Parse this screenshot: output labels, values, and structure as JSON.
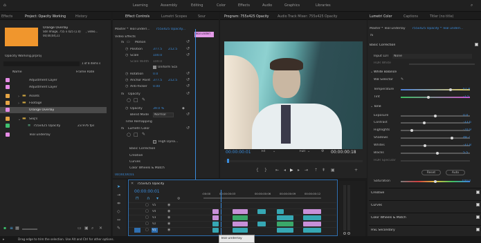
{
  "workspaces": [
    "Learning",
    "Assembly",
    "Editing",
    "Color",
    "Effects",
    "Audio",
    "Graphics",
    "Libraries"
  ],
  "project_panel": {
    "tabs": [
      "Effects",
      "Project: Opacity Working",
      "History"
    ],
    "clip_name": "Orange Overlay",
    "clip_info": "Still Image, 755 x 425 (1.0)",
    "clip_info2": ", video...",
    "clip_duration": "00;00;04;21",
    "project_file": "Opacity Working.prproj",
    "item_count": "1 of 8 items s",
    "col_name": "Name",
    "col_rate": "Frame Rate",
    "items": [
      {
        "name": "Adjustment Layer",
        "color": "#e58be6",
        "rate": ""
      },
      {
        "name": "Adjustment Layer",
        "color": "#e58be6",
        "rate": ""
      },
      {
        "name": "Assets",
        "color": "#e5a545",
        "rate": ""
      },
      {
        "name": "Footage",
        "color": "#e5a545",
        "rate": ""
      },
      {
        "name": "Orange Overlay",
        "color": "#e58be6",
        "rate": ""
      },
      {
        "name": "Seq's",
        "color": "#e5a545",
        "rate": ""
      },
      {
        "name": "755x425 Opacity",
        "color": "#3fbf6f",
        "rate": "23.976 fps"
      },
      {
        "name": "Teal underlay",
        "color": "#e58be6",
        "rate": ""
      }
    ]
  },
  "effect_controls": {
    "tabs": [
      "Effect Controls",
      "Lumetri Scopes",
      "Sour"
    ],
    "master": "Master * Teal underl...",
    "clip_link": "755x425 Opacity...",
    "clip_label": "Teal underl",
    "video_effects": "Video Effects",
    "motion": "Motion",
    "position_label": "Position",
    "position_x": "377.5",
    "position_y": "212.5",
    "scale_label": "Scale",
    "scale_val": "100.0",
    "scale_width_label": "Scale Width",
    "scale_width_val": "100.0",
    "uniform": "Uniform Sca",
    "rotation_label": "Rotation",
    "rotation_val": "0.0",
    "anchor_label": "Anchor Point",
    "anchor_x": "377.5",
    "anchor_y": "212.5",
    "antiflicker_label": "Anti-flicker",
    "antiflicker_val": "0.00",
    "opacity": "Opacity",
    "opacity_label": "Opacity",
    "opacity_val": "39.0 %",
    "blend_label": "Blend Mode",
    "blend_val": "Normal",
    "time_remap": "Time Remapping",
    "lumetri": "Lumetri Color",
    "high_dyn": "High Dyna...",
    "sub_items": [
      "Basic Correction",
      "Creative",
      "Curves",
      "Color Wheels & Match"
    ],
    "timecode": "00;00;00;01"
  },
  "program_monitor": {
    "tabs": [
      "Program: 755x425 Opacity",
      "Audio Track Mixer: 755x425 Opacity"
    ],
    "timecode": "00:00:00:01",
    "fit": "Fit",
    "quality": "Full",
    "duration": "00:00:00:18"
  },
  "timeline": {
    "title": "755x425 Opacity",
    "timecode": "00:00:00:01",
    "ruler": [
      ":00:00",
      "00:00:00:03",
      "00:00:00:06",
      "00:00:00:09",
      "00:00:00:12"
    ],
    "tracks": [
      "V5",
      "V4",
      "V3",
      "V2",
      "V1"
    ]
  },
  "lumetri": {
    "tabs": [
      "Lumetri Color",
      "Captions",
      "Titler (no title)"
    ],
    "master": "Master * Teal underlay",
    "clip_link": "755x425 Opacity * Teal underl...",
    "basic": "Basic Correction",
    "input_lut_label": "Input LUT",
    "input_lut_val": "None",
    "hdr_label": "HDR White",
    "white_balance": "White Balance",
    "wb_selector": "WB Selector",
    "temperature_label": "Temperature",
    "temperature_val": "61.8",
    "tint_label": "Tint",
    "tint_val": "-2.5",
    "tone": "Tone",
    "exposure_label": "Exposure",
    "exposure_val": "0.0",
    "contrast_label": "Contrast",
    "contrast_val": "-33.6",
    "highlights_label": "Highlights",
    "highlights_val": "-70.9",
    "shadows_label": "Shadows",
    "shadows_val": "48.7",
    "whites_label": "Whites",
    "whites_val": "-31.8",
    "blacks_label": "Blacks",
    "blacks_val": "5.5",
    "hdr_spec_label": "HDR Specular",
    "reset": "Reset",
    "auto": "Auto",
    "saturation_label": "Saturation",
    "saturation_val": "100.0",
    "sections": [
      "Creative",
      "Curves",
      "Color Wheels & Match",
      "HSL Secondary"
    ]
  },
  "status": {
    "hint": "Drag edge to trim the selection. Use Alt and Ctrl for other options.",
    "tooltip": "Teal underlay"
  },
  "colors": {
    "accent": "#3a8dde",
    "clip_pink": "#c890d8",
    "clip_teal": "#36a8b4",
    "clip_green": "#3aa86a"
  }
}
